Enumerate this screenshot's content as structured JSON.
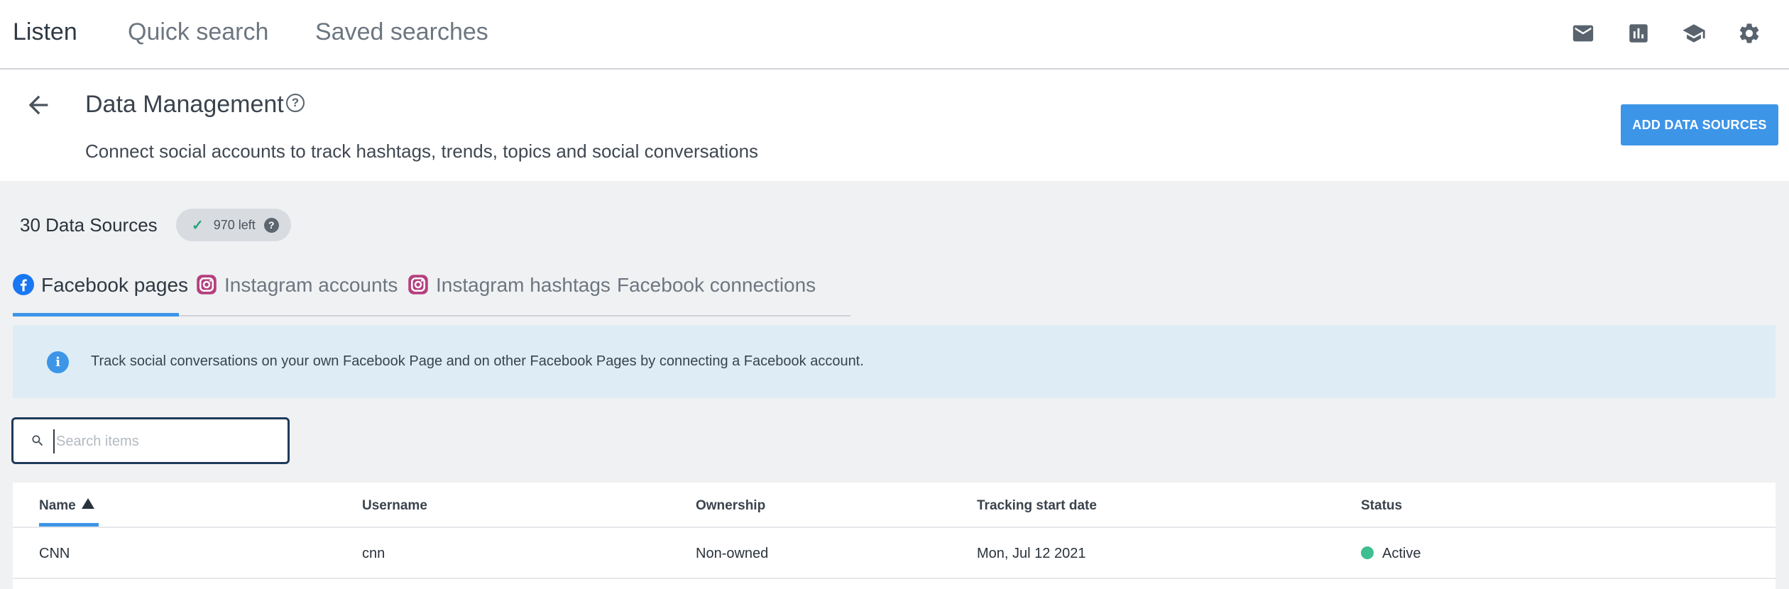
{
  "nav": {
    "items": [
      {
        "label": "Listen",
        "active": true
      },
      {
        "label": "Quick search",
        "active": false
      },
      {
        "label": "Saved searches",
        "active": false
      }
    ],
    "icons": [
      "mail-icon",
      "analytics-icon",
      "academy-icon",
      "settings-gear-icon"
    ]
  },
  "header": {
    "title": "Data Management",
    "help_symbol": "?",
    "subtitle": "Connect social accounts to track hashtags, trends, topics and social conversations",
    "add_button_label": "ADD DATA SOURCES"
  },
  "summary": {
    "count_label": "30 Data Sources",
    "quota_label": "970 left",
    "quota_help": "?"
  },
  "tabs": [
    {
      "label": "Facebook pages",
      "icon": "facebook-icon",
      "active": true
    },
    {
      "label": "Instagram accounts",
      "icon": "instagram-icon",
      "active": false
    },
    {
      "label": "Instagram hashtags",
      "icon": "instagram-icon",
      "active": false
    },
    {
      "label": "Facebook connections",
      "icon": "",
      "active": false
    }
  ],
  "info_banner": {
    "text": "Track social conversations on your own Facebook Page and on other Facebook Pages by connecting a Facebook account."
  },
  "search": {
    "placeholder": "Search items",
    "value": ""
  },
  "table": {
    "columns": [
      "Name",
      "Username",
      "Ownership",
      "Tracking start date",
      "Status"
    ],
    "sort": {
      "column": "Name",
      "direction": "ascending"
    },
    "rows": [
      {
        "name": "CNN",
        "username": "cnn",
        "ownership": "Non-owned",
        "tracking_start": "Mon, Jul 12 2021",
        "status": "Active"
      }
    ]
  },
  "colors": {
    "accent": "#3d95e8",
    "status_active": "#3fbf8f",
    "instagram": "#b5407e",
    "facebook": "#1877f2"
  }
}
